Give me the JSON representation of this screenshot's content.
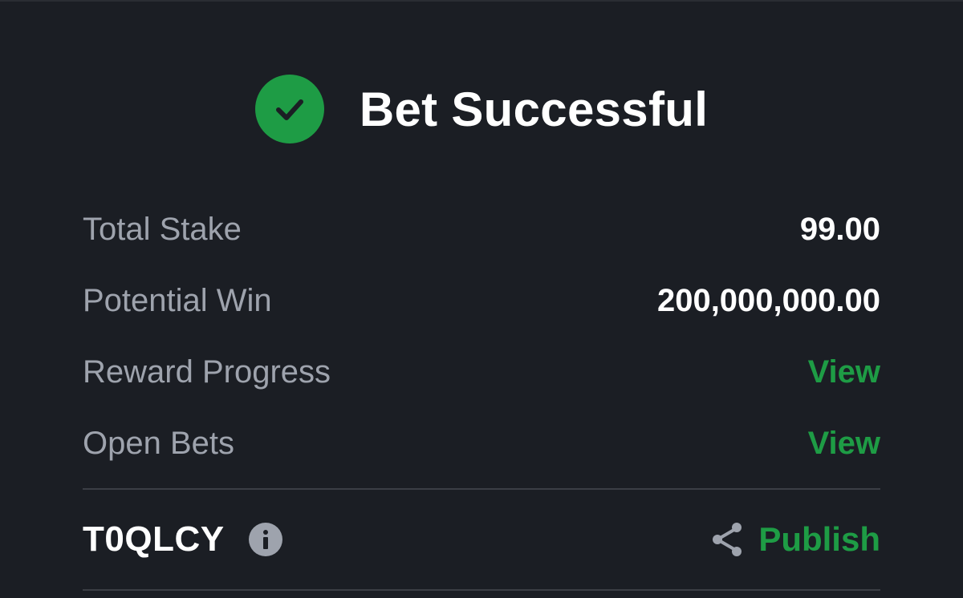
{
  "header": {
    "title": "Bet Successful",
    "icon": "check-circle-icon",
    "accent_color": "#1e9c45"
  },
  "summary": {
    "total_stake": {
      "label": "Total Stake",
      "value": "99.00"
    },
    "potential_win": {
      "label": "Potential Win",
      "value": "200,000,000.00"
    },
    "reward_progress": {
      "label": "Reward Progress",
      "link": "View"
    },
    "open_bets": {
      "label": "Open Bets",
      "link": "View"
    }
  },
  "footer": {
    "booking_code": "T0QLCY",
    "info_icon": "info-icon",
    "share_icon": "share-icon",
    "publish_label": "Publish"
  }
}
